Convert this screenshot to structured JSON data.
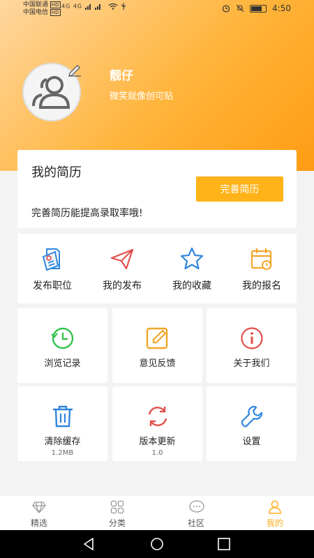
{
  "status_bar": {
    "carrier1": "中国联通",
    "carrier1_badge": "HD",
    "carrier2": "中国电信",
    "carrier2_badge": "HD",
    "network": "4G 4G",
    "time": "4:50"
  },
  "profile": {
    "username": "靓仔",
    "motto": "微笑就像创可贴"
  },
  "resume": {
    "title": "我的简历",
    "button_label": "完善简历",
    "hint": "完善简历能提高录取率哦!"
  },
  "quick_actions": [
    {
      "label": "发布职位",
      "icon": "post-job-icon"
    },
    {
      "label": "我的发布",
      "icon": "paper-plane-icon"
    },
    {
      "label": "我的收藏",
      "icon": "star-icon"
    },
    {
      "label": "我的报名",
      "icon": "calendar-icon"
    }
  ],
  "tiles": [
    {
      "label": "浏览记录",
      "icon": "history-icon"
    },
    {
      "label": "意见反馈",
      "icon": "edit-icon"
    },
    {
      "label": "关于我们",
      "icon": "info-icon"
    },
    {
      "label": "清除缓存",
      "sub": "1.2MB",
      "icon": "trash-icon"
    },
    {
      "label": "版本更新",
      "sub": "1.0",
      "icon": "refresh-icon"
    },
    {
      "label": "设置",
      "icon": "wrench-icon"
    }
  ],
  "tabbar": [
    {
      "label": "精选",
      "icon": "diamond-icon"
    },
    {
      "label": "分类",
      "icon": "grid-icon"
    },
    {
      "label": "社区",
      "icon": "chat-icon"
    },
    {
      "label": "我的",
      "icon": "person-icon",
      "active": true
    }
  ],
  "colors": {
    "accent": "#ffb319",
    "blue": "#2f86de",
    "red": "#e0504a",
    "green": "#36c24d",
    "orange": "#f3a62a"
  }
}
